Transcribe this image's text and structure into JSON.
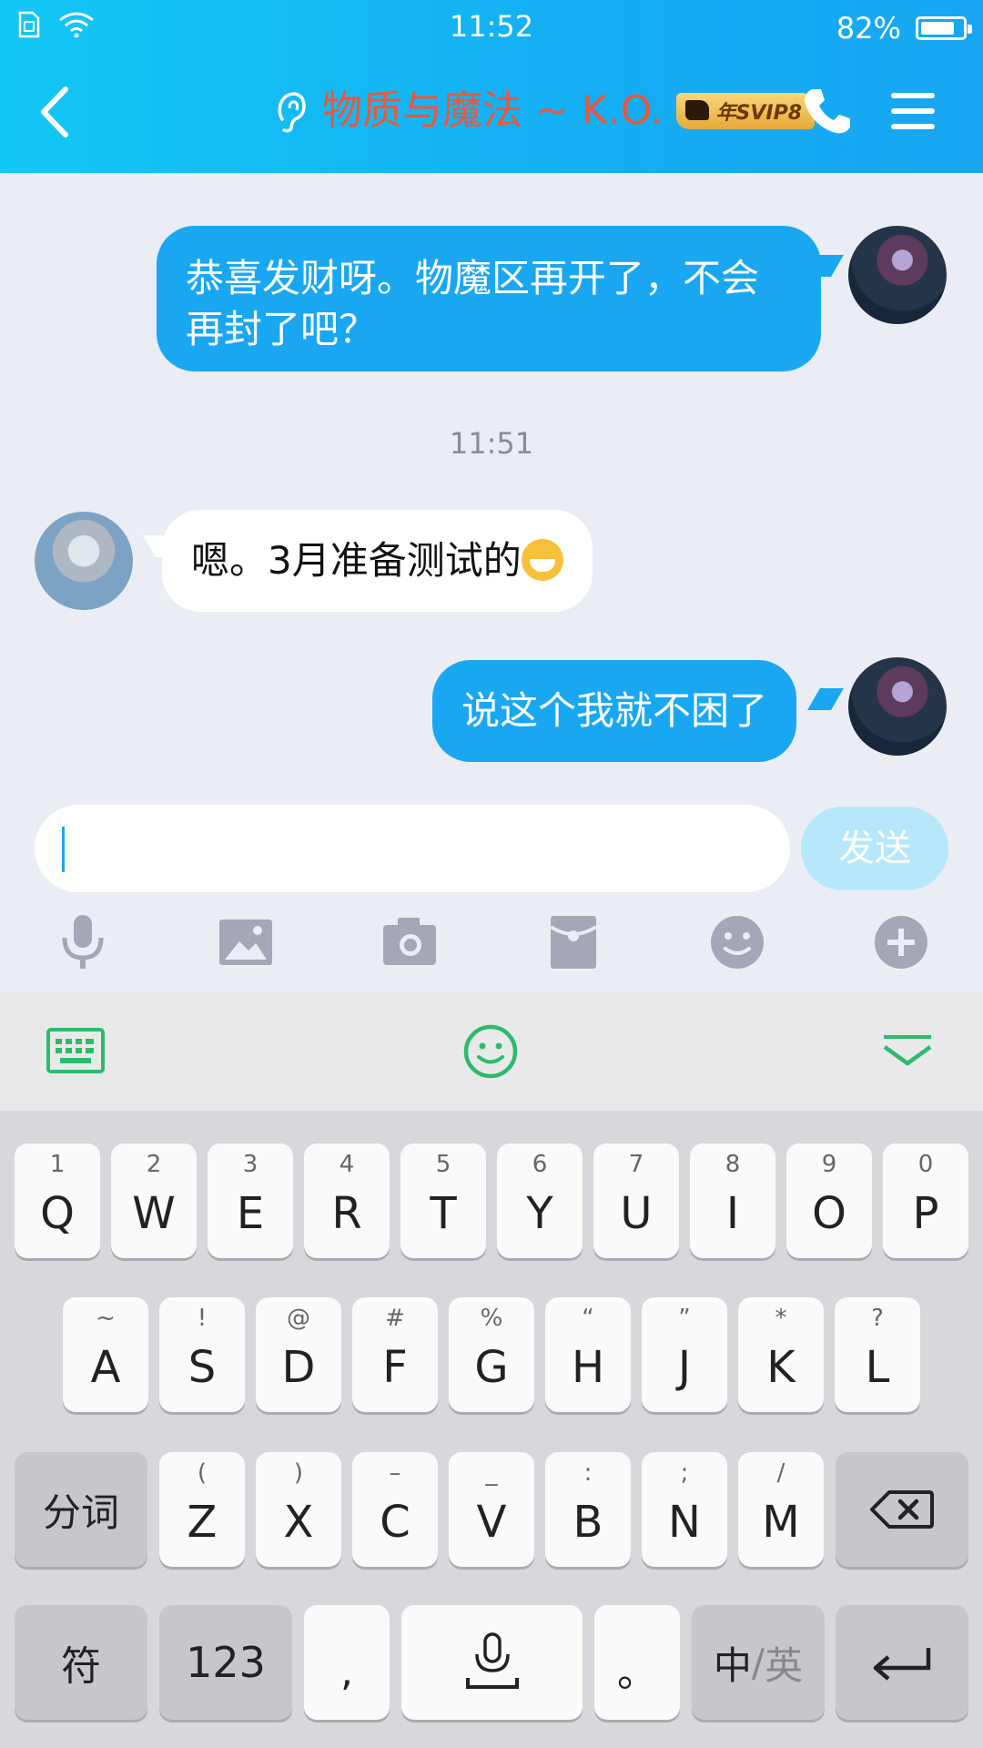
{
  "status_bar": {
    "time": "11:52",
    "battery_text": "82%",
    "battery_level": 0.82
  },
  "header": {
    "title": "物质与魔法 ~ K.O.",
    "vip_badge": "年SVIP8"
  },
  "chat": {
    "messages": [
      {
        "side": "out",
        "text": "恭喜发财呀。物魔区再开了，不会再封了吧？"
      },
      {
        "side": "in",
        "text": "嗯。3月准备测试的"
      },
      {
        "side": "out",
        "text": "说这个我就不困了"
      }
    ],
    "timestamp": "11:51"
  },
  "input": {
    "value": "",
    "send_label": "发送"
  },
  "toolbar": {
    "icons": [
      "microphone-icon",
      "image-icon",
      "camera-icon",
      "red-packet-icon",
      "emoji-icon",
      "plus-icon"
    ]
  },
  "keyboard": {
    "row1": [
      {
        "hint": "1",
        "key": "Q"
      },
      {
        "hint": "2",
        "key": "W"
      },
      {
        "hint": "3",
        "key": "E"
      },
      {
        "hint": "4",
        "key": "R"
      },
      {
        "hint": "5",
        "key": "T"
      },
      {
        "hint": "6",
        "key": "Y"
      },
      {
        "hint": "7",
        "key": "U"
      },
      {
        "hint": "8",
        "key": "I"
      },
      {
        "hint": "9",
        "key": "O"
      },
      {
        "hint": "0",
        "key": "P"
      }
    ],
    "row2": [
      {
        "hint": "~",
        "key": "A"
      },
      {
        "hint": "!",
        "key": "S"
      },
      {
        "hint": "@",
        "key": "D"
      },
      {
        "hint": "#",
        "key": "F"
      },
      {
        "hint": "%",
        "key": "G"
      },
      {
        "hint": "“",
        "key": "H"
      },
      {
        "hint": "”",
        "key": "J"
      },
      {
        "hint": "*",
        "key": "K"
      },
      {
        "hint": "?",
        "key": "L"
      }
    ],
    "row3": [
      {
        "hint": "(",
        "key": "Z"
      },
      {
        "hint": ")",
        "key": "X"
      },
      {
        "hint": "–",
        "key": "C"
      },
      {
        "hint": "_",
        "key": "V"
      },
      {
        "hint": ":",
        "key": "B"
      },
      {
        "hint": ";",
        "key": "N"
      },
      {
        "hint": "/",
        "key": "M"
      }
    ],
    "segment_key": "分词",
    "symbol_key": "符",
    "num_key": "123",
    "comma_key": ",",
    "period_key": "。",
    "lang_key_cn": "中",
    "lang_key_sep": "/",
    "lang_key_en": "英"
  },
  "colors": {
    "header_gradient_start": "#13c7f5",
    "header_gradient_end": "#18a6f2",
    "bubble_out": "#1aa7f2",
    "title_red": "#e8583c",
    "kb_green": "#2dbb6b"
  }
}
